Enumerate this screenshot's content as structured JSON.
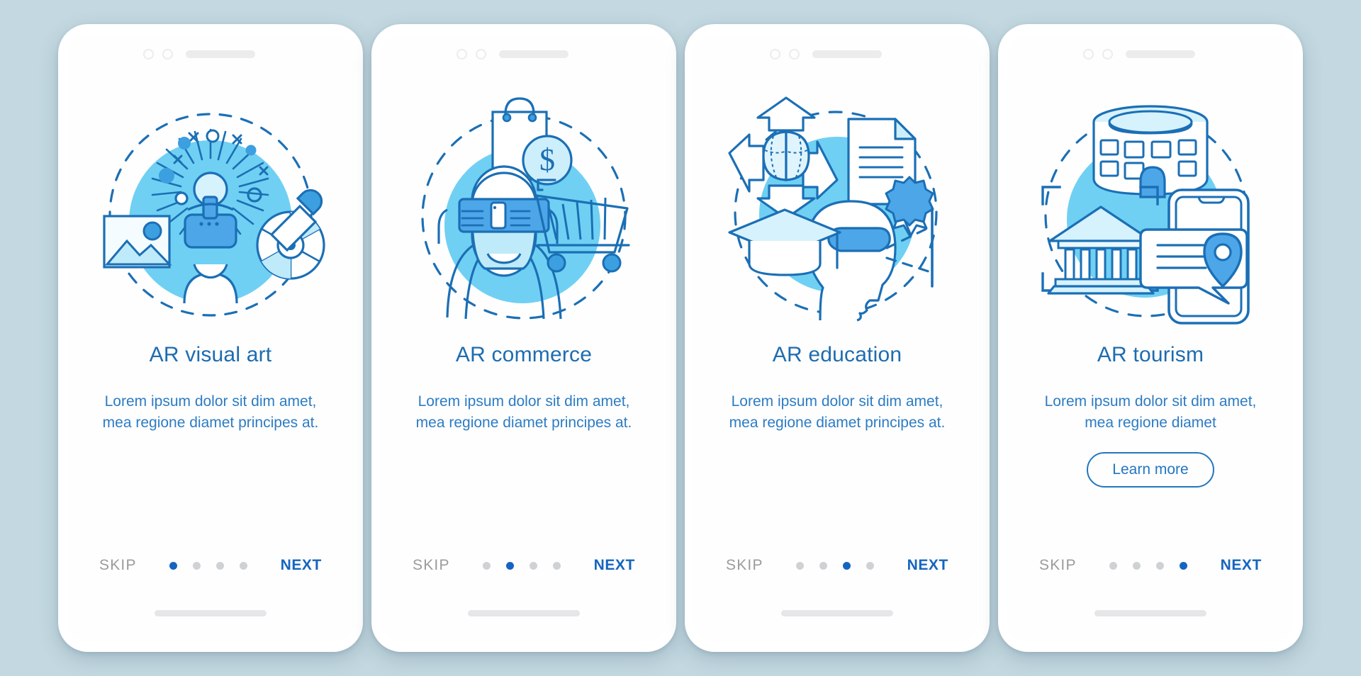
{
  "page": {
    "background_color": "#c3d8e0",
    "accent_color": "#1565c0",
    "title_color": "#1d6cb0",
    "body_color": "#2c7cc4",
    "muted_color": "#9b9b9b",
    "illustration_fill": "#6fd0f3"
  },
  "screens": [
    {
      "id": "ar-visual-art",
      "illustration": "vr-headset-person-image-palette-icon",
      "title": "AR visual art",
      "description": "Lorem ipsum dolor sit dim amet, mea regione diamet principes at.",
      "description_lines": [
        "Lorem ipsum dolor sit dim",
        "amet, mea regione diamet",
        "principes at."
      ],
      "cta": null,
      "skip_label": "SKIP",
      "next_label": "NEXT",
      "dots_total": 4,
      "dot_active_index": 0
    },
    {
      "id": "ar-commerce",
      "illustration": "shopping-bag-cart-dollar-phone-icon",
      "title": "AR commerce",
      "description": "Lorem ipsum dolor sit dim amet, mea regione diamet principes at.",
      "description_lines": [
        "Lorem ipsum dolor sit dim",
        "amet, mea regione diamet",
        "principes at."
      ],
      "cta": null,
      "skip_label": "SKIP",
      "next_label": "NEXT",
      "dots_total": 4,
      "dot_active_index": 1
    },
    {
      "id": "ar-education",
      "illustration": "brain-arrows-diploma-graduation-cap-icon",
      "title": "AR education",
      "description": "Lorem ipsum dolor sit dim amet, mea regione diamet principes at.",
      "description_lines": [
        "Lorem ipsum dolor sit dim",
        "amet, mea regione diamet",
        "principes at."
      ],
      "cta": null,
      "skip_label": "SKIP",
      "next_label": "NEXT",
      "dots_total": 4,
      "dot_active_index": 2
    },
    {
      "id": "ar-tourism",
      "illustration": "colosseum-museum-smartphone-map-pin-icon",
      "title": "AR tourism",
      "description": "Lorem ipsum dolor sit dim amet, mea regione diamet",
      "description_lines": [
        "Lorem ipsum dolor sit dim",
        "amet, mea regione diamet"
      ],
      "cta": "Learn more",
      "skip_label": "SKIP",
      "next_label": "NEXT",
      "dots_total": 4,
      "dot_active_index": 3
    }
  ]
}
